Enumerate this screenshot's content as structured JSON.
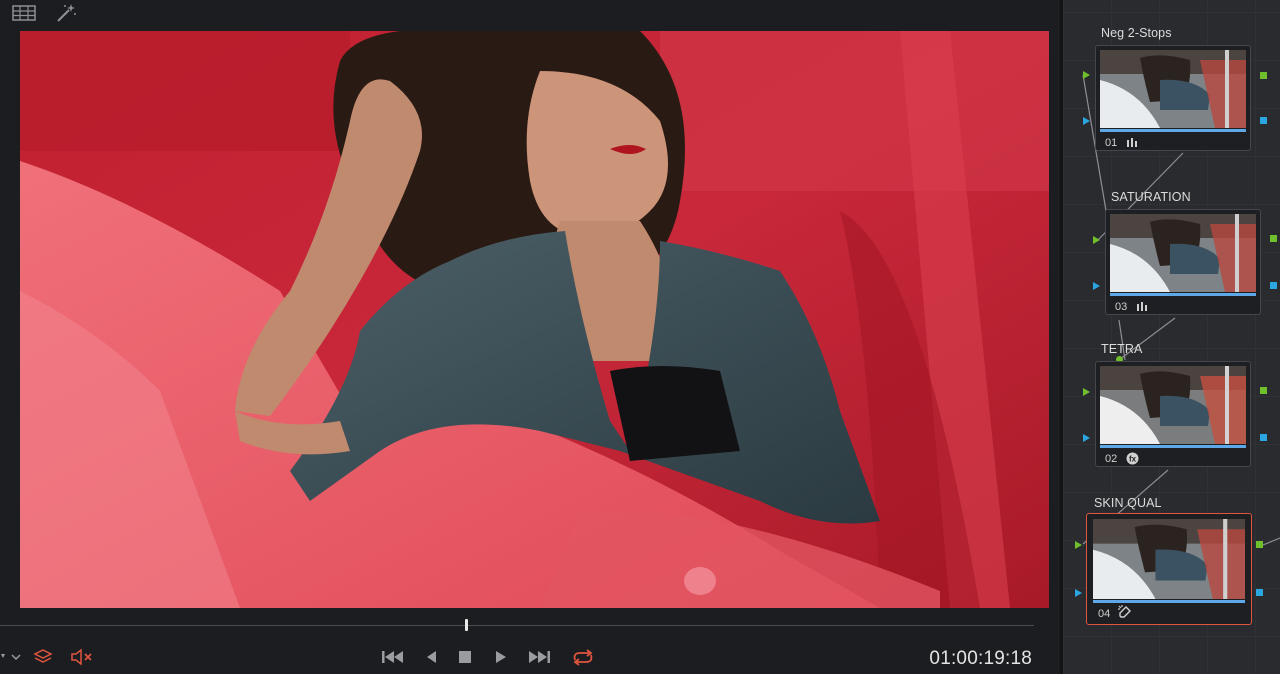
{
  "viewer": {
    "toolbar": {
      "grid_icon": "grid-view-icon",
      "magic_icon": "magic-wand-icon"
    },
    "timecode": "01:00:19:18",
    "playhead_progress": 0.45,
    "transport": {
      "icons": [
        "jump-to-start-icon",
        "step-back-icon",
        "stop-icon",
        "play-icon",
        "jump-to-end-icon",
        "loop-icon"
      ]
    },
    "left_controls": [
      "layers-icon",
      "mute-icon"
    ]
  },
  "node_graph": {
    "nodes": [
      {
        "label": "Neg 2-Stops",
        "number": "01",
        "icon": "levels-icon",
        "selected": false
      },
      {
        "label": "SATURATION",
        "number": "03",
        "icon": "levels-icon",
        "selected": false
      },
      {
        "label": "TETRA",
        "number": "02",
        "icon": "fx-icon",
        "selected": false
      },
      {
        "label": "SKIN QUAL",
        "number": "04",
        "icon": "qualifier-picker-icon",
        "selected": true
      }
    ]
  },
  "colors": {
    "accent_red": "#e0553f",
    "port_green": "#6fc02c",
    "port_blue": "#2aa7e0"
  }
}
